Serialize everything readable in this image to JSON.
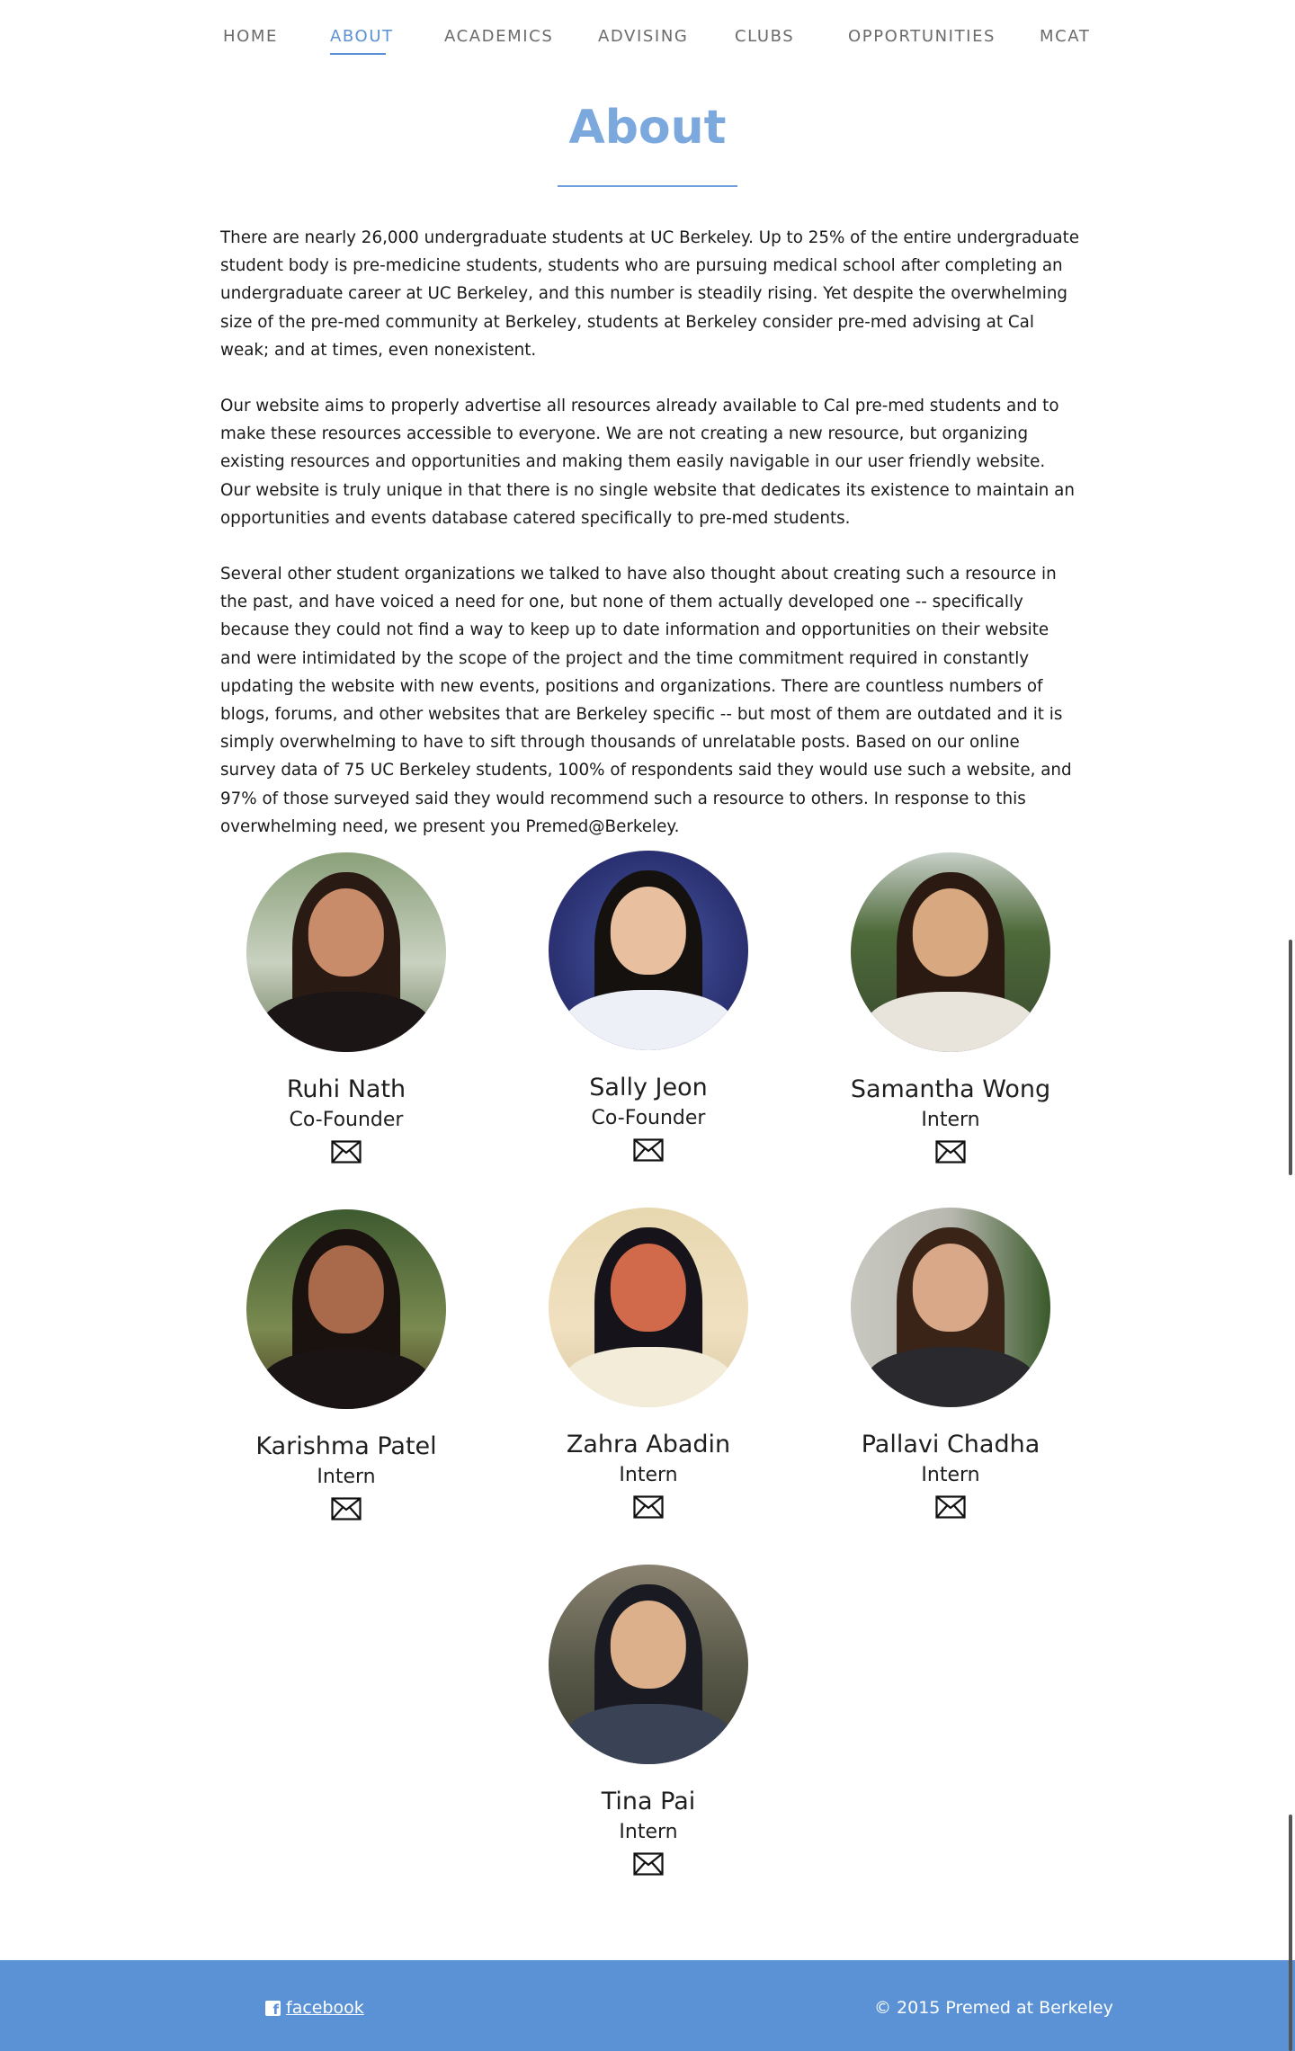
{
  "nav": {
    "items": [
      {
        "label": "HOME"
      },
      {
        "label": "ABOUT",
        "active": true
      },
      {
        "label": "ACADEMICS"
      },
      {
        "label": "ADVISING"
      },
      {
        "label": "CLUBS"
      },
      {
        "label": "OPPORTUNITIES"
      },
      {
        "label": "MCAT"
      }
    ]
  },
  "page": {
    "title": "About",
    "paragraphs": [
      "There are nearly 26,000 undergraduate students at UC Berkeley. Up to 25% of the entire undergraduate student body is pre-medicine students, students who are pursuing medical school after completing an undergraduate career at UC Berkeley, and this number is steadily rising. Yet despite the overwhelming size of the pre-med community at Berkeley, students at Berkeley consider pre-med advising at Cal weak; and at times, even nonexistent.",
      "Our website aims to properly advertise all resources already available to Cal pre-med students and to make these resources accessible to everyone. We are not creating a new resource, but organizing existing resources and opportunities and making them easily navigable in our user friendly website. Our website is truly unique in that there is no single website that dedicates its existence to maintain an opportunities and events database catered specifically to pre-med students.",
      "Several other student organizations we talked to have also thought about creating such a resource in the past, and have voiced a need for one, but none of them actually developed one -- specifically because they could not find a way to keep up to date information and opportunities on their website and were intimidated by the scope of the project and the time commitment required in constantly updating the website with new events, positions and organizations. There are countless numbers of blogs, forums, and other websites that are Berkeley specific -- but most of them are outdated and it is simply overwhelming to have to sift through thousands of unrelatable posts. Based on our online survey data of 75 UC Berkeley students, 100% of respondents said they would use such a website, and 97% of those surveyed said they would recommend such a resource to others. In response to this overwhelming need, we present you Premed@Berkeley."
    ]
  },
  "team": [
    {
      "name": "Ruhi Nath",
      "role": "Co-Founder",
      "icon": "mail-icon"
    },
    {
      "name": "Sally Jeon",
      "role": "Co-Founder",
      "icon": "mail-icon"
    },
    {
      "name": "Samantha Wong",
      "role": "Intern",
      "icon": "mail-icon"
    },
    {
      "name": "Karishma Patel",
      "role": "Intern",
      "icon": "mail-icon"
    },
    {
      "name": "Zahra Abadin",
      "role": "Intern",
      "icon": "mail-icon"
    },
    {
      "name": "Pallavi Chadha",
      "role": "Intern",
      "icon": "mail-icon"
    },
    {
      "name": "Tina Pai",
      "role": "Intern",
      "icon": "mail-icon"
    }
  ],
  "footer": {
    "facebook_label": "facebook",
    "copyright": "© 2015 Premed at Berkeley"
  },
  "colors": {
    "accent": "#5b92d6",
    "title": "#7ba8dd"
  }
}
